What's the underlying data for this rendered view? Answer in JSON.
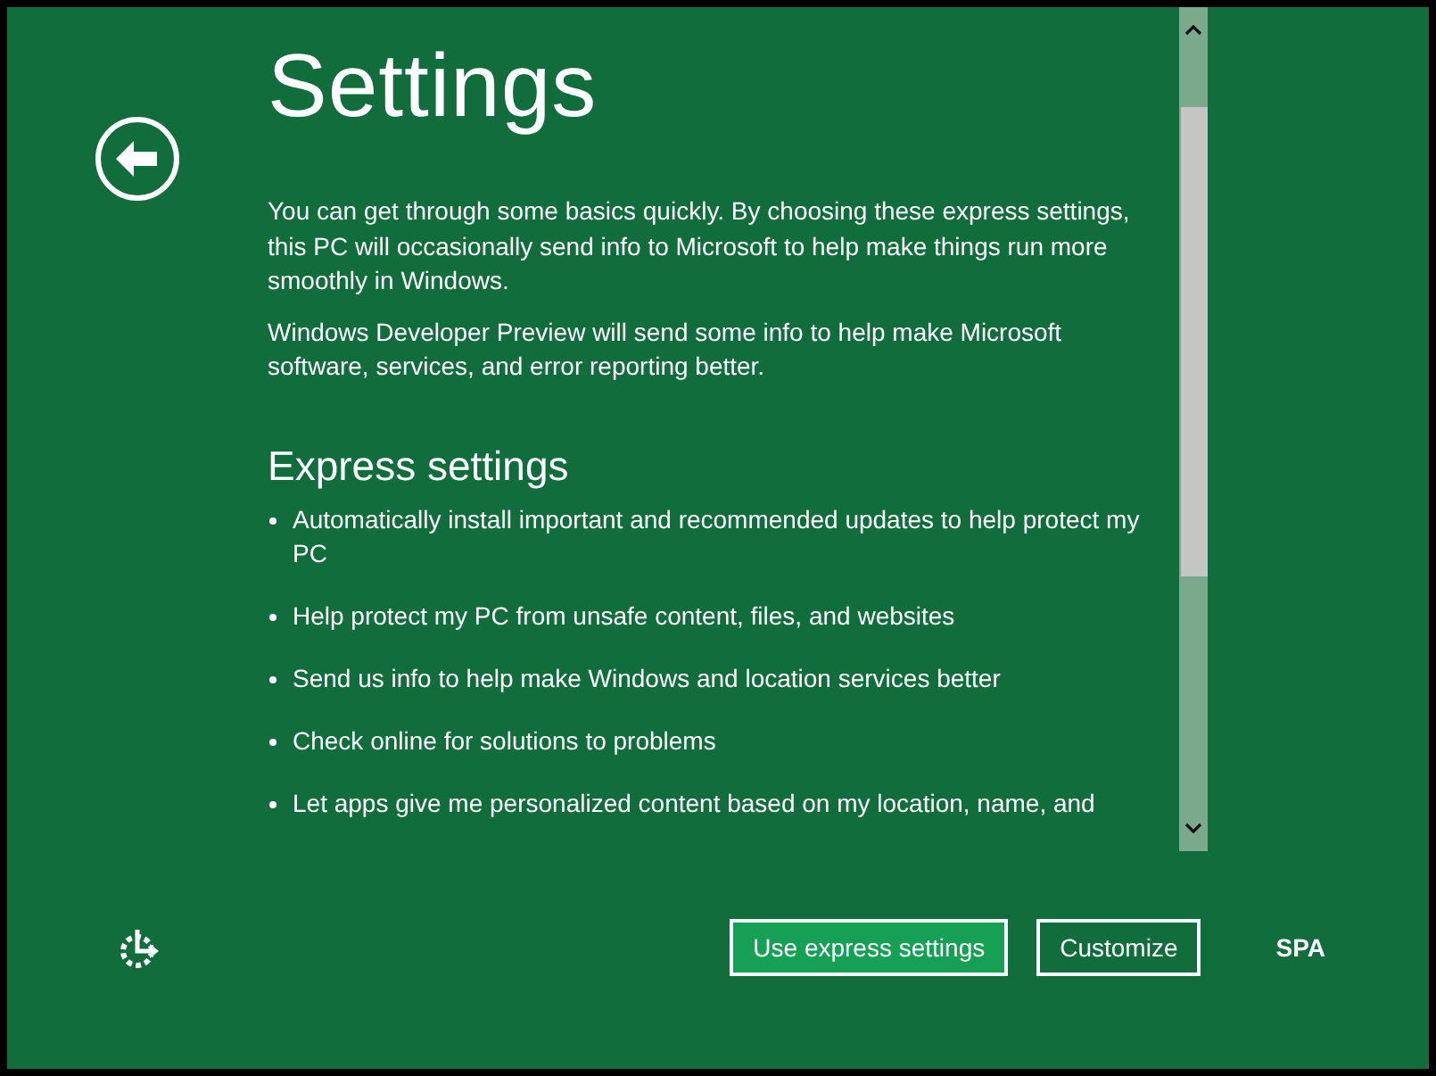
{
  "title": "Settings",
  "paragraphs": [
    "You can get through some basics quickly. By choosing these express settings, this PC will occasionally send info to Microsoft to help make things run more smoothly in Windows.",
    "Windows Developer Preview will send some info to help make Microsoft software, services, and error reporting better."
  ],
  "section_heading": "Express settings",
  "express_items": [
    "Automatically install important and recommended updates to help protect my PC",
    "Help protect my PC from unsafe content, files, and websites",
    "Send us info to help make Windows and location services better",
    "Check online for solutions to problems",
    "Let apps give me personalized content based on my location, name, and"
  ],
  "buttons": [
    {
      "label": "Use express settings",
      "kind": "primary"
    },
    {
      "label": "Customize",
      "kind": "secondary"
    }
  ],
  "language": "SPA"
}
